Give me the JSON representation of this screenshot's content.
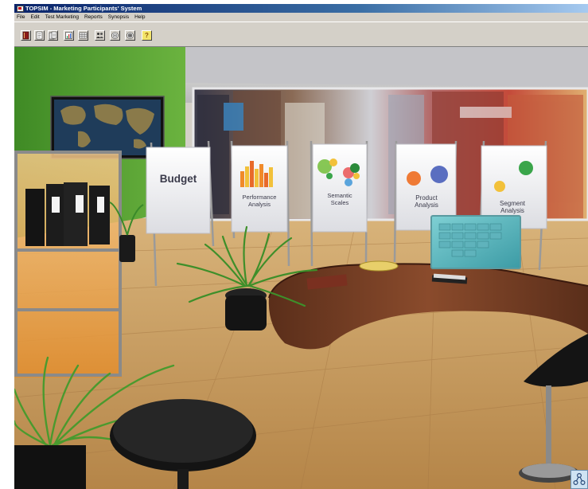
{
  "window": {
    "title": "TOPSIM - Marketing Participants' System"
  },
  "menu": {
    "items": [
      "File",
      "Edit",
      "Test Marketing",
      "Reports",
      "Synopsis",
      "Help"
    ]
  },
  "toolbar": {
    "buttons": [
      "book-icon",
      "document-icon",
      "documents-icon",
      "chart-icon",
      "table-icon",
      "people-icon",
      "target-icon",
      "target-alt-icon",
      "help-icon"
    ],
    "help_glyph": "?"
  },
  "scene": {
    "panels": {
      "budget": "Budget",
      "performance": [
        "Performance",
        "Analysis"
      ],
      "semantic": [
        "Semantic",
        "Scales"
      ],
      "product": [
        "Product",
        "Analysis"
      ],
      "segment": [
        "Segment",
        "Analysis"
      ]
    }
  },
  "colors": {
    "titlebar": "#0a246a",
    "wall_green": "#4f9b2f",
    "floor": "#c79a5c",
    "desk": "#6b3a22"
  }
}
